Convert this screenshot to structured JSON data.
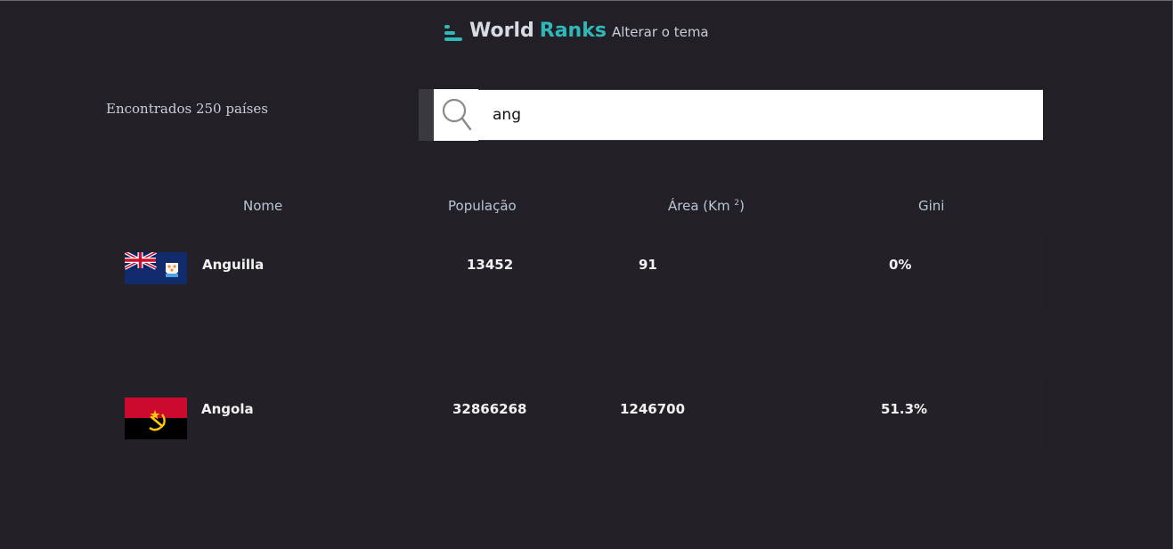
{
  "header": {
    "title_part1": "World",
    "title_part2": "Ranks",
    "theme_toggle": "Alterar o tema"
  },
  "results": {
    "count_text": "Encontrados 250 países"
  },
  "search": {
    "value": "ang",
    "placeholder": ""
  },
  "table": {
    "headers": {
      "name": "Nome",
      "population": "População",
      "area": "Área (Km",
      "area_sup": "2",
      "area_close": ")",
      "gini": "Gini"
    },
    "rows": [
      {
        "name": "Anguilla",
        "population": "13452",
        "area": "91",
        "gini": "0%",
        "flag": "anguilla-flag"
      },
      {
        "name": "Angola",
        "population": "32866268",
        "area": "1246700",
        "gini": "51.3%",
        "flag": "angola-flag"
      }
    ]
  },
  "colors": {
    "background": "#222026",
    "accent": "#2eb8b8",
    "text": "#f2f2f2",
    "muted": "#b7c6d6"
  },
  "icons": {
    "logo": "bar-chart-logo-icon",
    "search": "search-icon"
  }
}
